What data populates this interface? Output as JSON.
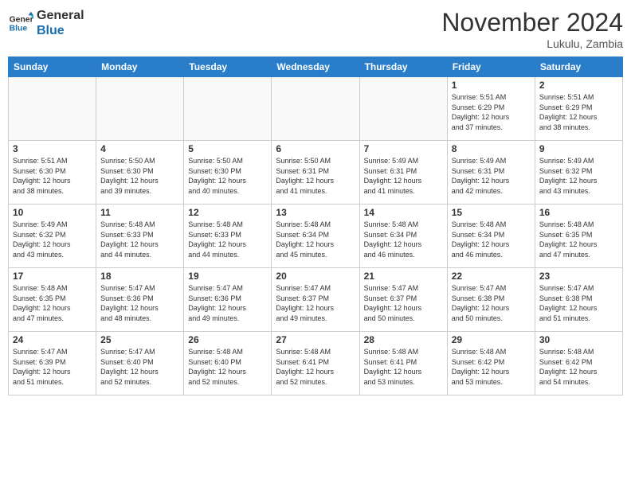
{
  "logo": {
    "line1": "General",
    "line2": "Blue"
  },
  "title": "November 2024",
  "location": "Lukulu, Zambia",
  "days_of_week": [
    "Sunday",
    "Monday",
    "Tuesday",
    "Wednesday",
    "Thursday",
    "Friday",
    "Saturday"
  ],
  "weeks": [
    [
      {
        "day": "",
        "info": ""
      },
      {
        "day": "",
        "info": ""
      },
      {
        "day": "",
        "info": ""
      },
      {
        "day": "",
        "info": ""
      },
      {
        "day": "",
        "info": ""
      },
      {
        "day": "1",
        "info": "Sunrise: 5:51 AM\nSunset: 6:29 PM\nDaylight: 12 hours\nand 37 minutes."
      },
      {
        "day": "2",
        "info": "Sunrise: 5:51 AM\nSunset: 6:29 PM\nDaylight: 12 hours\nand 38 minutes."
      }
    ],
    [
      {
        "day": "3",
        "info": "Sunrise: 5:51 AM\nSunset: 6:30 PM\nDaylight: 12 hours\nand 38 minutes."
      },
      {
        "day": "4",
        "info": "Sunrise: 5:50 AM\nSunset: 6:30 PM\nDaylight: 12 hours\nand 39 minutes."
      },
      {
        "day": "5",
        "info": "Sunrise: 5:50 AM\nSunset: 6:30 PM\nDaylight: 12 hours\nand 40 minutes."
      },
      {
        "day": "6",
        "info": "Sunrise: 5:50 AM\nSunset: 6:31 PM\nDaylight: 12 hours\nand 41 minutes."
      },
      {
        "day": "7",
        "info": "Sunrise: 5:49 AM\nSunset: 6:31 PM\nDaylight: 12 hours\nand 41 minutes."
      },
      {
        "day": "8",
        "info": "Sunrise: 5:49 AM\nSunset: 6:31 PM\nDaylight: 12 hours\nand 42 minutes."
      },
      {
        "day": "9",
        "info": "Sunrise: 5:49 AM\nSunset: 6:32 PM\nDaylight: 12 hours\nand 43 minutes."
      }
    ],
    [
      {
        "day": "10",
        "info": "Sunrise: 5:49 AM\nSunset: 6:32 PM\nDaylight: 12 hours\nand 43 minutes."
      },
      {
        "day": "11",
        "info": "Sunrise: 5:48 AM\nSunset: 6:33 PM\nDaylight: 12 hours\nand 44 minutes."
      },
      {
        "day": "12",
        "info": "Sunrise: 5:48 AM\nSunset: 6:33 PM\nDaylight: 12 hours\nand 44 minutes."
      },
      {
        "day": "13",
        "info": "Sunrise: 5:48 AM\nSunset: 6:34 PM\nDaylight: 12 hours\nand 45 minutes."
      },
      {
        "day": "14",
        "info": "Sunrise: 5:48 AM\nSunset: 6:34 PM\nDaylight: 12 hours\nand 46 minutes."
      },
      {
        "day": "15",
        "info": "Sunrise: 5:48 AM\nSunset: 6:34 PM\nDaylight: 12 hours\nand 46 minutes."
      },
      {
        "day": "16",
        "info": "Sunrise: 5:48 AM\nSunset: 6:35 PM\nDaylight: 12 hours\nand 47 minutes."
      }
    ],
    [
      {
        "day": "17",
        "info": "Sunrise: 5:48 AM\nSunset: 6:35 PM\nDaylight: 12 hours\nand 47 minutes."
      },
      {
        "day": "18",
        "info": "Sunrise: 5:47 AM\nSunset: 6:36 PM\nDaylight: 12 hours\nand 48 minutes."
      },
      {
        "day": "19",
        "info": "Sunrise: 5:47 AM\nSunset: 6:36 PM\nDaylight: 12 hours\nand 49 minutes."
      },
      {
        "day": "20",
        "info": "Sunrise: 5:47 AM\nSunset: 6:37 PM\nDaylight: 12 hours\nand 49 minutes."
      },
      {
        "day": "21",
        "info": "Sunrise: 5:47 AM\nSunset: 6:37 PM\nDaylight: 12 hours\nand 50 minutes."
      },
      {
        "day": "22",
        "info": "Sunrise: 5:47 AM\nSunset: 6:38 PM\nDaylight: 12 hours\nand 50 minutes."
      },
      {
        "day": "23",
        "info": "Sunrise: 5:47 AM\nSunset: 6:38 PM\nDaylight: 12 hours\nand 51 minutes."
      }
    ],
    [
      {
        "day": "24",
        "info": "Sunrise: 5:47 AM\nSunset: 6:39 PM\nDaylight: 12 hours\nand 51 minutes."
      },
      {
        "day": "25",
        "info": "Sunrise: 5:47 AM\nSunset: 6:40 PM\nDaylight: 12 hours\nand 52 minutes."
      },
      {
        "day": "26",
        "info": "Sunrise: 5:48 AM\nSunset: 6:40 PM\nDaylight: 12 hours\nand 52 minutes."
      },
      {
        "day": "27",
        "info": "Sunrise: 5:48 AM\nSunset: 6:41 PM\nDaylight: 12 hours\nand 52 minutes."
      },
      {
        "day": "28",
        "info": "Sunrise: 5:48 AM\nSunset: 6:41 PM\nDaylight: 12 hours\nand 53 minutes."
      },
      {
        "day": "29",
        "info": "Sunrise: 5:48 AM\nSunset: 6:42 PM\nDaylight: 12 hours\nand 53 minutes."
      },
      {
        "day": "30",
        "info": "Sunrise: 5:48 AM\nSunset: 6:42 PM\nDaylight: 12 hours\nand 54 minutes."
      }
    ]
  ]
}
